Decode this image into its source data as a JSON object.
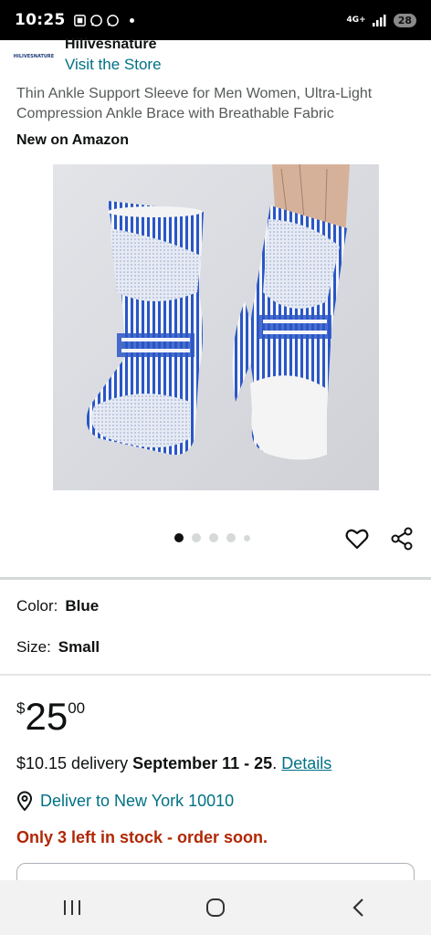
{
  "status_bar": {
    "time": "10:25",
    "network": "4G+",
    "battery": "28"
  },
  "store": {
    "logo_text": "HILIVESNATURE",
    "name": "Hilivesnature",
    "link": "Visit the Store"
  },
  "product": {
    "title": "Thin Ankle Support Sleeve for Men Women, Ultra-Light Compression Ankle Brace with Breathable Fabric",
    "badge": "New on Amazon",
    "carousel_count": 5,
    "carousel_active": 0
  },
  "variations": {
    "color_label": "Color:",
    "color_value": "Blue",
    "size_label": "Size:",
    "size_value": "Small"
  },
  "price": {
    "symbol": "$",
    "whole": "25",
    "fraction": "00"
  },
  "delivery": {
    "fee": "$10.15 delivery",
    "dates": "September 11 - 25",
    "period": ".",
    "details_link": "Details"
  },
  "deliver_to": "Deliver to New York 10010",
  "stock": "Only 3 left in stock - order soon.",
  "colors": {
    "link": "#007185",
    "stock": "#b12704",
    "text": "#0f1111",
    "muted": "#565959",
    "brace_blue": "#2a56c6"
  },
  "icons": {
    "heart": "heart-icon",
    "share": "share-icon",
    "location": "location-pin-icon",
    "nav_recents": "recents-icon",
    "nav_home": "home-icon",
    "nav_back": "back-icon"
  }
}
